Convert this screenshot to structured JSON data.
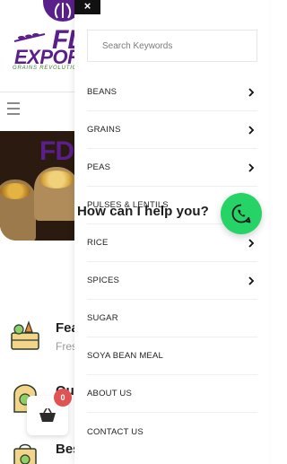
{
  "brand": {
    "logo_line1": "FD",
    "logo_line2": "EXPOR",
    "tagline": "GRAINS REVOLUTION",
    "hero_text": "FD"
  },
  "features": [
    {
      "title": "Fea",
      "subtitle": "Fres",
      "icon": "produce-crate-icon"
    },
    {
      "title": "Qu",
      "subtitle": "",
      "icon": "quality-sack-icon"
    },
    {
      "title": "Bes",
      "subtitle": "",
      "icon": "shopping-bag-icon"
    }
  ],
  "cart": {
    "count": "0"
  },
  "menu": {
    "close_label": "×",
    "search_placeholder": "Search Keywords",
    "items": [
      {
        "label": "BEANS",
        "has_submenu": true
      },
      {
        "label": "GRAINS",
        "has_submenu": true
      },
      {
        "label": "PEAS",
        "has_submenu": true
      },
      {
        "label": "PULSES & LENTILS",
        "has_submenu": false
      },
      {
        "label": "RICE",
        "has_submenu": true
      },
      {
        "label": "SPICES",
        "has_submenu": true
      },
      {
        "label": "SUGAR",
        "has_submenu": false
      },
      {
        "label": "SOYA BEAN MEAL",
        "has_submenu": false
      },
      {
        "label": "ABOUT US",
        "has_submenu": false
      },
      {
        "label": "CONTACT US",
        "has_submenu": false
      }
    ]
  },
  "chat": {
    "prompt": "How can I help you?",
    "icon": "whatsapp-icon"
  },
  "colors": {
    "brand_purple": "#5b1f8c",
    "whatsapp_green": "#25d366",
    "badge_red": "#e05353"
  }
}
